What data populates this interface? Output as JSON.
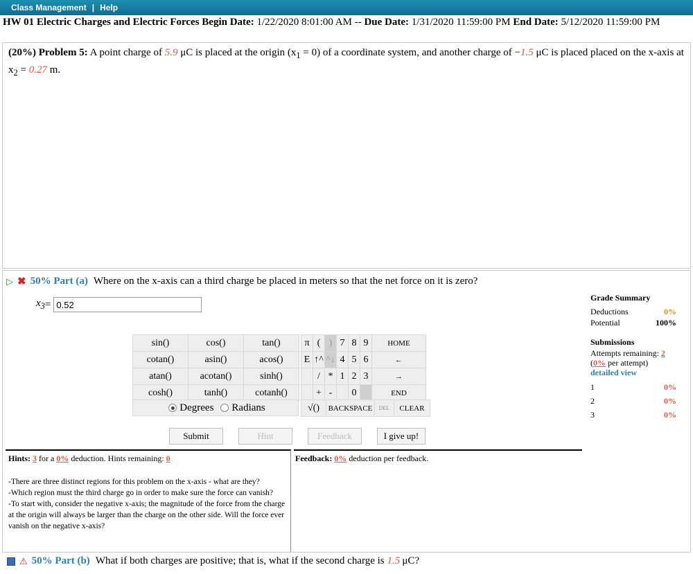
{
  "nav": {
    "class_management": "Class Management",
    "separator": "|",
    "help": "Help"
  },
  "hw": {
    "title": "HW 01 Electric Charges and Electric Forces",
    "begin_label": "Begin Date:",
    "begin": "1/22/2020 8:01:00 AM",
    "sep": "--",
    "due_label": "Due Date:",
    "due": "1/31/2020 11:59:00 PM",
    "end_label": "End Date:",
    "end": "5/12/2020 11:59:00 PM"
  },
  "problem": {
    "weight": "(20%)",
    "name": "Problem 5:",
    "t1": "A point charge of",
    "q1": "5.9",
    "t2": "μC is placed at the origin (x",
    "sub1": "1",
    "t3": " = 0) of a coordinate system, and another charge of −",
    "q2": "1.5",
    "t4": "μC is placed placed on the x-axis at x",
    "sub2": "2",
    "t5": " = ",
    "x2": "0.27",
    "t6": "m."
  },
  "partA": {
    "pct": "50% Part (a)",
    "question": "Where on the x-axis can a third charge be placed in meters so that the net force on it is zero?",
    "var": "x",
    "var_sub": "3",
    "eq": " = ",
    "value": "0.52"
  },
  "calc": {
    "functions": [
      [
        "sin()",
        "cos()",
        "tan()"
      ],
      [
        "cotan()",
        "asin()",
        "acos()"
      ],
      [
        "atan()",
        "acotan()",
        "sinh()"
      ],
      [
        "cosh()",
        "tanh()",
        "cotanh()"
      ]
    ],
    "keys": [
      [
        "π",
        "(",
        ")",
        "7",
        "8",
        "9",
        "HOME"
      ],
      [
        "E",
        "↑^",
        "^↓",
        "4",
        "5",
        "6",
        "←"
      ],
      [
        "",
        "/",
        "*",
        "1",
        "2",
        "3",
        "→"
      ],
      [
        "",
        "+",
        "-",
        "",
        "0",
        "",
        "END"
      ]
    ],
    "bottom": [
      "√()",
      "BACKSPACE",
      "DEL",
      "CLEAR"
    ],
    "degrees": "Degrees",
    "radians": "Radians"
  },
  "buttons": {
    "submit": "Submit",
    "hint": "Hint",
    "feedback": "Feedback",
    "give_up": "I give up!"
  },
  "hints": {
    "label": "Hints:",
    "count": "3",
    "for_a": "for a",
    "pct": "0%",
    "deduction": "deduction. Hints remaining:",
    "remaining": "0",
    "text": "-There are three distinct regions for this problem on the x-axis - what are they?\n-Which region must the third charge go in order to make sure the force can vanish?\n-To start with, consider the negative x-axis; the magnitude of the force from the charge at the origin will always be larger than the charge on the other side. Will the force ever vanish on the negative x-axis?"
  },
  "feedback": {
    "label": "Feedback:",
    "pct": "0%",
    "text": "deduction per feedback."
  },
  "grade": {
    "title": "Grade Summary",
    "deductions_label": "Deductions",
    "deductions": "0%",
    "potential_label": "Potential",
    "potential": "100%"
  },
  "submissions": {
    "title": "Submissions",
    "attempts_label": "Attempts remaining:",
    "attempts": "2",
    "per_pct": "0%",
    "per_label": "per attempt)",
    "detailed": "detailed view",
    "rows": [
      {
        "n": "1",
        "v": "0%"
      },
      {
        "n": "2",
        "v": "0%"
      },
      {
        "n": "3",
        "v": "0%"
      }
    ]
  },
  "partB": {
    "pct": "50% Part (b)",
    "question": "What if both charges are positive; that is, what if the second charge is",
    "q": "1.5",
    "unit": "μC?"
  }
}
